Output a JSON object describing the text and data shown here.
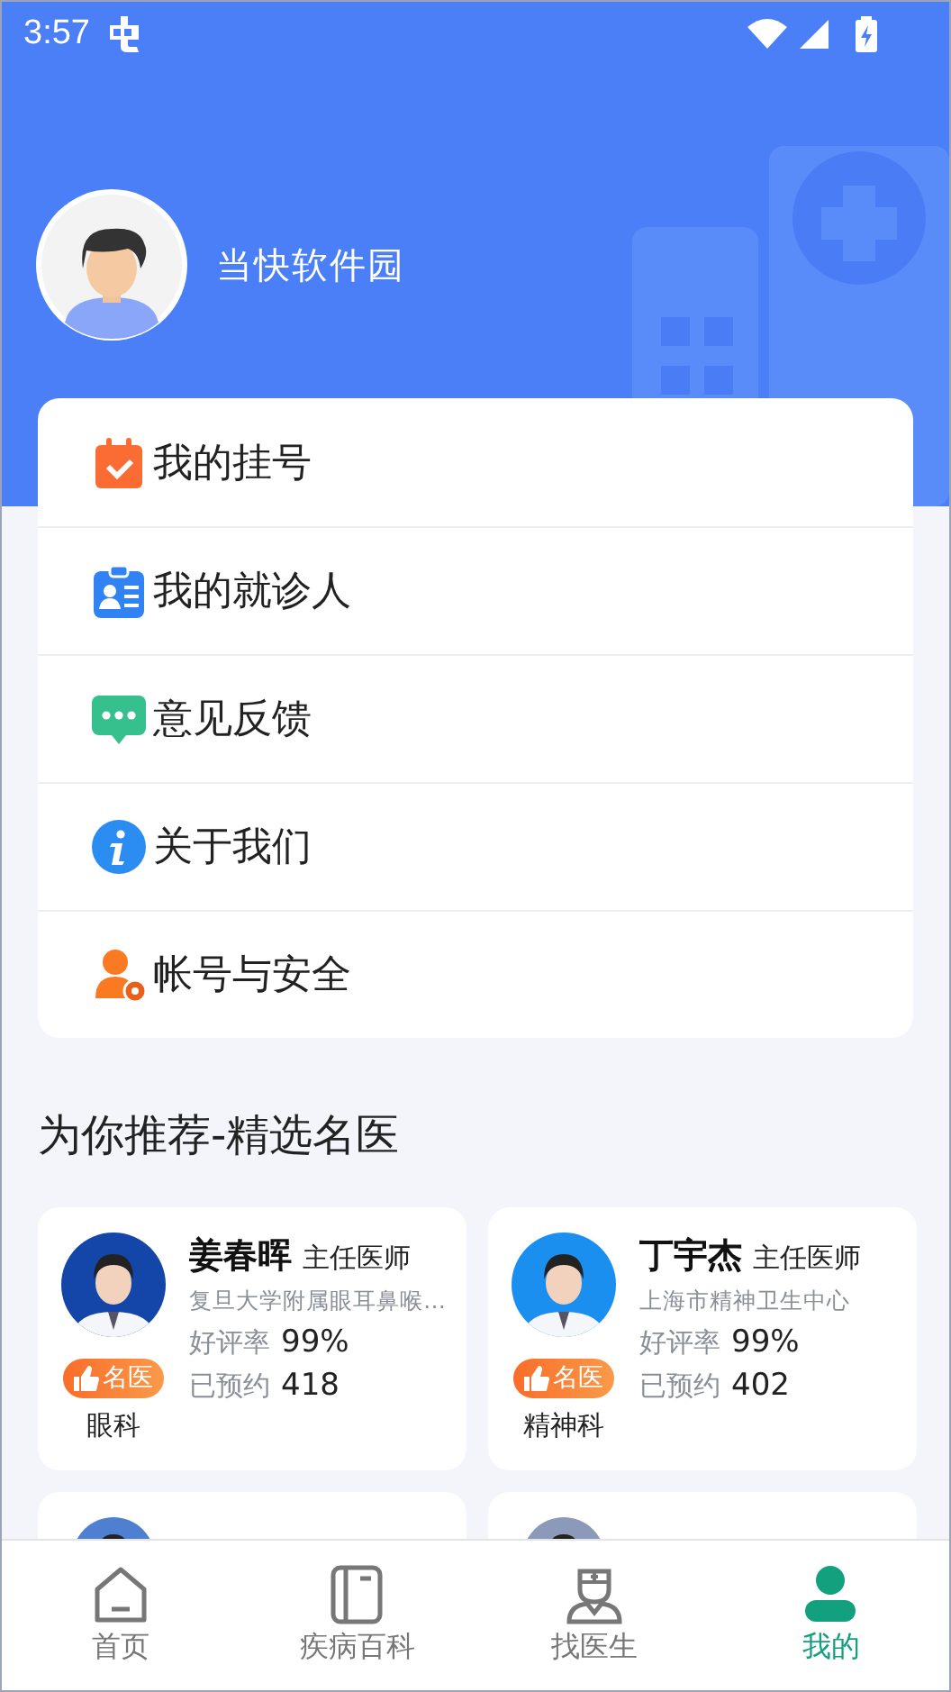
{
  "status_bar": {
    "time": "3:57"
  },
  "profile": {
    "name": "当快软件园"
  },
  "menu": [
    {
      "label": "我的挂号"
    },
    {
      "label": "我的就诊人"
    },
    {
      "label": "意见反馈"
    },
    {
      "label": "关于我们"
    },
    {
      "label": "帐号与安全"
    }
  ],
  "section_title": "为你推荐-精选名医",
  "doctors": [
    {
      "kind": "full",
      "name": "姜春晖",
      "title": "主任医师",
      "hospital": "复旦大学附属眼耳鼻喉…",
      "badge": "名医",
      "department": "眼科",
      "rating_label": "好评率",
      "rating": "99%",
      "booked_label": "已预约",
      "booked": "418"
    },
    {
      "kind": "full",
      "name": "丁宇杰",
      "title": "主任医师",
      "hospital": "上海市精神卫生中心",
      "badge": "名医",
      "department": "精神科",
      "rating_label": "好评率",
      "rating": "99%",
      "booked_label": "已预约",
      "booked": "402"
    },
    {
      "kind": "cut"
    },
    {
      "kind": "cut"
    }
  ],
  "tabs": [
    {
      "label": "首页",
      "selected": false
    },
    {
      "label": "疾病百科",
      "selected": false
    },
    {
      "label": "找医生",
      "selected": false
    },
    {
      "label": "我的",
      "selected": true
    }
  ]
}
